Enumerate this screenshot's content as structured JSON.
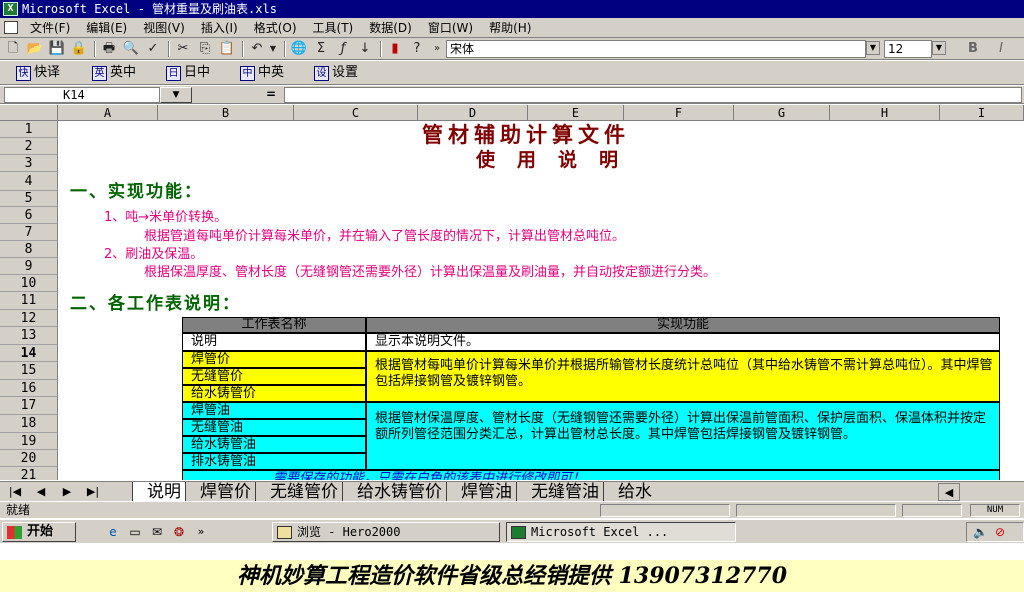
{
  "window": {
    "title": "Microsoft Excel - 管材重量及刷油表.xls",
    "app_icon": "X"
  },
  "menu": [
    "文件(F)",
    "编辑(E)",
    "视图(V)",
    "插入(I)",
    "格式(O)",
    "工具(T)",
    "数据(D)",
    "窗口(W)",
    "帮助(H)"
  ],
  "toolbar": {
    "font_name": "宋体",
    "font_size": "12",
    "bold": "B",
    "italic": "I"
  },
  "ime_bar": [
    "快译",
    "英中",
    "日中",
    "中英",
    "设置"
  ],
  "ime_icons": [
    "快",
    "英",
    "日",
    "中",
    "设"
  ],
  "formula": {
    "cell_ref": "K14",
    "eq": "="
  },
  "columns": [
    "A",
    "B",
    "C",
    "D",
    "E",
    "F",
    "G",
    "H",
    "I"
  ],
  "rows": [
    "1",
    "2",
    "3",
    "4",
    "5",
    "6",
    "7",
    "8",
    "9",
    "10",
    "11",
    "12",
    "13",
    "14",
    "15",
    "16",
    "17",
    "18",
    "19",
    "20",
    "21"
  ],
  "doc": {
    "title1": "管材辅助计算文件",
    "title2": "使用说明",
    "sec1": "一、实现功能：",
    "item1": "1、吨→米单价转换。",
    "item1_desc": "根据管道每吨单价计算每米单价，并在输入了管长度的情况下，计算出管材总吨位。",
    "item2": "2、刷油及保温。",
    "item2_desc": "根据保温厚度、管材长度（无缝钢管还需要外径）计算出保温量及刷油量，并自动按定额进行分类。",
    "sec2": "二、各工作表说明：",
    "table": {
      "col1": "工作表名称",
      "col2": "实现功能",
      "r1_name": "说明",
      "r1_func": "显示本说明文件。",
      "g1_names": [
        "焊管价",
        "无缝管价",
        "给水铸管价"
      ],
      "g1_func": "根据管材每吨单价计算每米单价并根据所输管材长度统计总吨位（其中给水铸管不需计算总吨位）。其中焊管包括焊接钢管及镀锌钢管。",
      "g2_names": [
        "焊管油",
        "无缝管油",
        "给水铸管油",
        "排水铸管油"
      ],
      "g2_func": "根据管材保温厚度、管材长度（无缝钢管还需要外径）计算出保温前管面积、保护层面积、保温体积并按定额所列管径范围分类汇总，计算出管材总长度。其中焊管包括焊接钢管及镀锌钢管。",
      "note": "需要保存的功能，只需在白色的该表中进行修改即可！"
    }
  },
  "sheet_tabs": [
    "说明",
    "焊管价",
    "无缝管价",
    "给水铸管价",
    "焊管油",
    "无缝管油",
    "给水"
  ],
  "status": {
    "ready": "就绪",
    "num": "NUM"
  },
  "taskbar": {
    "start": "开始",
    "task1": "浏览 - Hero2000",
    "task2": "Microsoft Excel ..."
  },
  "banner": "神机妙算工程造价软件省级总经销提供 13907312770"
}
